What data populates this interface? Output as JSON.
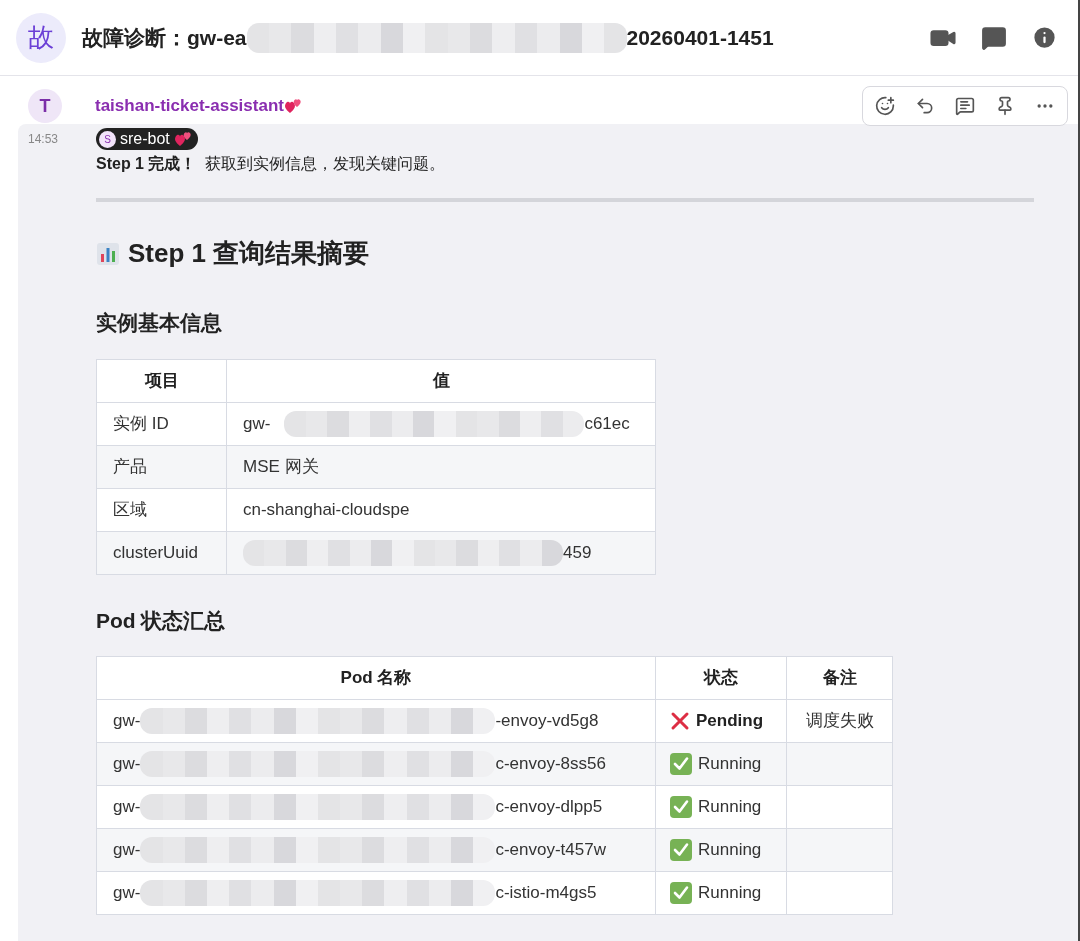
{
  "header": {
    "avatar": "故",
    "title_prefix": "故障诊断：gw-ea",
    "title_redacted": true,
    "title_suffix": "20260401-1451"
  },
  "message": {
    "avatar": "T",
    "sender": "taishan-ticket-assistant",
    "time": "14:53",
    "mention": {
      "avatar": "S",
      "name": "sre-bot"
    },
    "intro_bold": "Step 1 完成！",
    "intro": "获取到实例信息，发现关键问题。",
    "heading": "Step 1 查询结果摘要",
    "info_title": "实例基本信息",
    "info_table": {
      "columns": [
        "项目",
        "值"
      ],
      "rows": [
        {
          "label": "实例 ID",
          "value_prefix": "gw-",
          "value_suffix": "c61ec",
          "redacted": true
        },
        {
          "label": "产品",
          "value_prefix": "MSE 网关",
          "value_suffix": "",
          "redacted": false
        },
        {
          "label": "区域",
          "value_prefix": "cn-shanghai-cloudspe",
          "value_suffix": "",
          "redacted": false
        },
        {
          "label": "clusterUuid",
          "value_prefix": "",
          "value_suffix": "459",
          "redacted": true
        }
      ]
    },
    "pod_title": "Pod 状态汇总",
    "pod_table": {
      "columns": [
        "Pod 名称",
        "状态",
        "备注"
      ],
      "rows": [
        {
          "name_prefix": "gw-",
          "name_suffix": "-envoy-vd5g8",
          "status": {
            "kind": "pending",
            "label": "Pending"
          },
          "note": "调度失败"
        },
        {
          "name_prefix": "gw-",
          "name_suffix": "c-envoy-8ss56",
          "status": {
            "kind": "running",
            "label": "Running"
          },
          "note": ""
        },
        {
          "name_prefix": "gw-",
          "name_suffix": "c-envoy-dlpp5",
          "status": {
            "kind": "running",
            "label": "Running"
          },
          "note": ""
        },
        {
          "name_prefix": "gw-",
          "name_suffix": "c-envoy-t457w",
          "status": {
            "kind": "running",
            "label": "Running"
          },
          "note": ""
        },
        {
          "name_prefix": "gw-",
          "name_suffix": "c-istio-m4gs5",
          "status": {
            "kind": "running",
            "label": "Running"
          },
          "note": ""
        }
      ]
    }
  }
}
